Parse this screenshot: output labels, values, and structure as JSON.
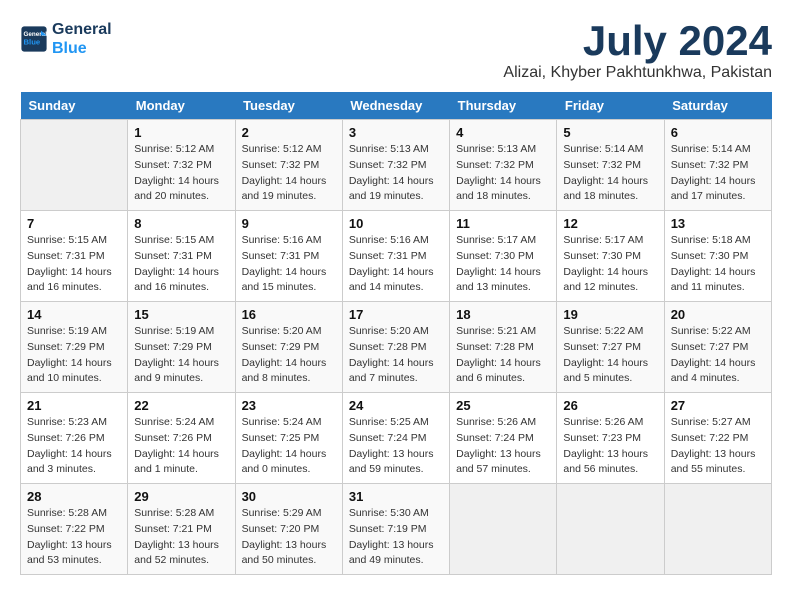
{
  "header": {
    "logo_line1": "General",
    "logo_line2": "Blue",
    "title": "July 2024",
    "subtitle": "Alizai, Khyber Pakhtunkhwa, Pakistan"
  },
  "weekdays": [
    "Sunday",
    "Monday",
    "Tuesday",
    "Wednesday",
    "Thursday",
    "Friday",
    "Saturday"
  ],
  "weeks": [
    [
      {
        "day": "",
        "info": ""
      },
      {
        "day": "1",
        "info": "Sunrise: 5:12 AM\nSunset: 7:32 PM\nDaylight: 14 hours\nand 20 minutes."
      },
      {
        "day": "2",
        "info": "Sunrise: 5:12 AM\nSunset: 7:32 PM\nDaylight: 14 hours\nand 19 minutes."
      },
      {
        "day": "3",
        "info": "Sunrise: 5:13 AM\nSunset: 7:32 PM\nDaylight: 14 hours\nand 19 minutes."
      },
      {
        "day": "4",
        "info": "Sunrise: 5:13 AM\nSunset: 7:32 PM\nDaylight: 14 hours\nand 18 minutes."
      },
      {
        "day": "5",
        "info": "Sunrise: 5:14 AM\nSunset: 7:32 PM\nDaylight: 14 hours\nand 18 minutes."
      },
      {
        "day": "6",
        "info": "Sunrise: 5:14 AM\nSunset: 7:32 PM\nDaylight: 14 hours\nand 17 minutes."
      }
    ],
    [
      {
        "day": "7",
        "info": "Sunrise: 5:15 AM\nSunset: 7:31 PM\nDaylight: 14 hours\nand 16 minutes."
      },
      {
        "day": "8",
        "info": "Sunrise: 5:15 AM\nSunset: 7:31 PM\nDaylight: 14 hours\nand 16 minutes."
      },
      {
        "day": "9",
        "info": "Sunrise: 5:16 AM\nSunset: 7:31 PM\nDaylight: 14 hours\nand 15 minutes."
      },
      {
        "day": "10",
        "info": "Sunrise: 5:16 AM\nSunset: 7:31 PM\nDaylight: 14 hours\nand 14 minutes."
      },
      {
        "day": "11",
        "info": "Sunrise: 5:17 AM\nSunset: 7:30 PM\nDaylight: 14 hours\nand 13 minutes."
      },
      {
        "day": "12",
        "info": "Sunrise: 5:17 AM\nSunset: 7:30 PM\nDaylight: 14 hours\nand 12 minutes."
      },
      {
        "day": "13",
        "info": "Sunrise: 5:18 AM\nSunset: 7:30 PM\nDaylight: 14 hours\nand 11 minutes."
      }
    ],
    [
      {
        "day": "14",
        "info": "Sunrise: 5:19 AM\nSunset: 7:29 PM\nDaylight: 14 hours\nand 10 minutes."
      },
      {
        "day": "15",
        "info": "Sunrise: 5:19 AM\nSunset: 7:29 PM\nDaylight: 14 hours\nand 9 minutes."
      },
      {
        "day": "16",
        "info": "Sunrise: 5:20 AM\nSunset: 7:29 PM\nDaylight: 14 hours\nand 8 minutes."
      },
      {
        "day": "17",
        "info": "Sunrise: 5:20 AM\nSunset: 7:28 PM\nDaylight: 14 hours\nand 7 minutes."
      },
      {
        "day": "18",
        "info": "Sunrise: 5:21 AM\nSunset: 7:28 PM\nDaylight: 14 hours\nand 6 minutes."
      },
      {
        "day": "19",
        "info": "Sunrise: 5:22 AM\nSunset: 7:27 PM\nDaylight: 14 hours\nand 5 minutes."
      },
      {
        "day": "20",
        "info": "Sunrise: 5:22 AM\nSunset: 7:27 PM\nDaylight: 14 hours\nand 4 minutes."
      }
    ],
    [
      {
        "day": "21",
        "info": "Sunrise: 5:23 AM\nSunset: 7:26 PM\nDaylight: 14 hours\nand 3 minutes."
      },
      {
        "day": "22",
        "info": "Sunrise: 5:24 AM\nSunset: 7:26 PM\nDaylight: 14 hours\nand 1 minute."
      },
      {
        "day": "23",
        "info": "Sunrise: 5:24 AM\nSunset: 7:25 PM\nDaylight: 14 hours\nand 0 minutes."
      },
      {
        "day": "24",
        "info": "Sunrise: 5:25 AM\nSunset: 7:24 PM\nDaylight: 13 hours\nand 59 minutes."
      },
      {
        "day": "25",
        "info": "Sunrise: 5:26 AM\nSunset: 7:24 PM\nDaylight: 13 hours\nand 57 minutes."
      },
      {
        "day": "26",
        "info": "Sunrise: 5:26 AM\nSunset: 7:23 PM\nDaylight: 13 hours\nand 56 minutes."
      },
      {
        "day": "27",
        "info": "Sunrise: 5:27 AM\nSunset: 7:22 PM\nDaylight: 13 hours\nand 55 minutes."
      }
    ],
    [
      {
        "day": "28",
        "info": "Sunrise: 5:28 AM\nSunset: 7:22 PM\nDaylight: 13 hours\nand 53 minutes."
      },
      {
        "day": "29",
        "info": "Sunrise: 5:28 AM\nSunset: 7:21 PM\nDaylight: 13 hours\nand 52 minutes."
      },
      {
        "day": "30",
        "info": "Sunrise: 5:29 AM\nSunset: 7:20 PM\nDaylight: 13 hours\nand 50 minutes."
      },
      {
        "day": "31",
        "info": "Sunrise: 5:30 AM\nSunset: 7:19 PM\nDaylight: 13 hours\nand 49 minutes."
      },
      {
        "day": "",
        "info": ""
      },
      {
        "day": "",
        "info": ""
      },
      {
        "day": "",
        "info": ""
      }
    ]
  ]
}
